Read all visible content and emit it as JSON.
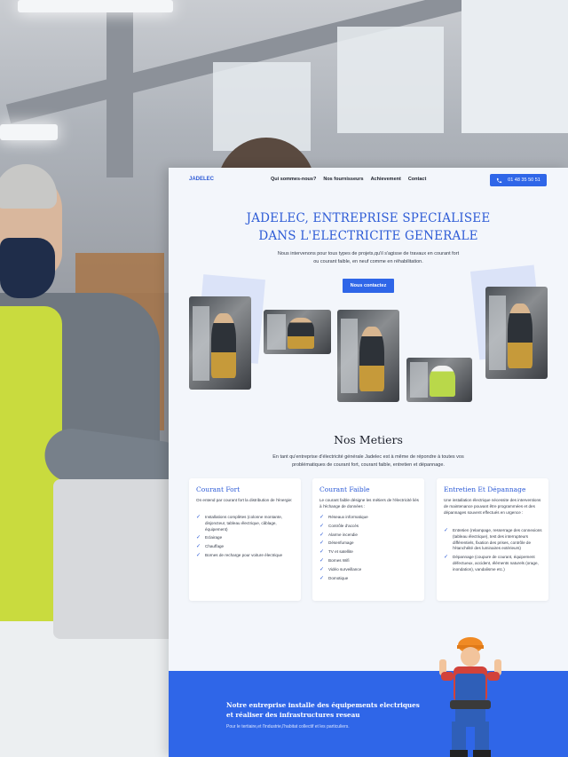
{
  "site": {
    "logo": "JADELEC",
    "nav": [
      "Qui sommes-nous?",
      "Nos fournisseurs",
      "Achievement",
      "Contact"
    ],
    "phone": "01 48 35 50 51"
  },
  "hero": {
    "title_line1": "JADELEC, ENTREPRISE SPECIALISEE",
    "title_line2": "DANS L'ELECTRICITE GENERALE",
    "subtitle": "Nous intervenons pour tous types de projets,qu'il s'agisse de travaux en courant fort ou courant faible, en neuf comme en réhabilitation.",
    "cta": "Nous contactez"
  },
  "metiers": {
    "title": "Nos Metiers",
    "subtitle": "En tant qu'entreprise d'électricité générale Jadelec est à même de répondre à toutes vos problématiques de courant fort, courant faible, entretien et dépannage.",
    "cards": [
      {
        "title": "Courant Fort",
        "intro": "On entend par courant fort la distribution de l'énergie:",
        "items": [
          "Installations complètes (colonne montante, disjoncteur, tableau électrique, câblage, équipement)",
          "Eclairage",
          "Chauffage",
          "Bornes de recharge pour voiture électrique"
        ]
      },
      {
        "title": "Courant Faible",
        "intro": "Le courant faible désigne les métiers de l'électricité liés à l'échange de données :",
        "items": [
          "Réseaux informatique",
          "Contrôle d'accès",
          "Alarme incendie",
          "Désenfumage",
          "TV et satellite",
          "Bornes Wifi",
          "Vidéo surveillance",
          "Domotique"
        ]
      },
      {
        "title": "Entretien Et Dépannage",
        "intro": "Une installation électrique nécessite des interventions de maintenance pouvant être programmées et des dépannages souvent effectués en urgence :",
        "items": [
          "Entretien (relampage, resserrage des connexions (tableau électrique), test des interrupteurs différentiels, fixation des prises, contrôle de l'étanchéité des luminaires extérieurs)",
          "Dépannage (coupure de courant, équipement défectueux, accident, éléments naturels (orage, inondation), vandalisme etc.)"
        ]
      }
    ]
  },
  "band": {
    "title": "Notre entreprise installe des équipements electriques et réaliser des infrastructures reseau",
    "subtitle": "Pour le tertiaire,et l'industrie,l'habitat collectif et les particuliers."
  },
  "colors": {
    "accent": "#2f66e8",
    "title": "#2d5bd6",
    "page_bg": "#f3f6fb"
  }
}
